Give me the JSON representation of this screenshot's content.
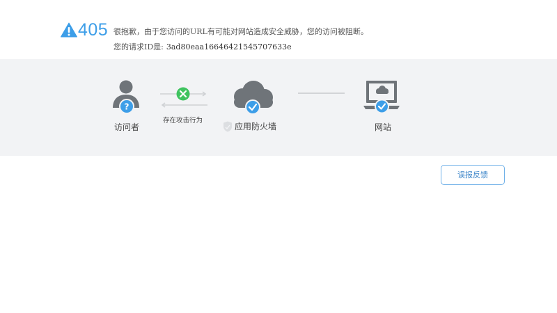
{
  "header": {
    "warning_icon": "warning-triangle-icon",
    "code": "405",
    "message": "很抱歉，由于您访问的URL有可能对网站造成安全威胁，您的访问被阻断。",
    "request_id_label": "您的请求ID是:",
    "request_id": "3ad80eaa16646421545707633e"
  },
  "diagram": {
    "visitor": {
      "label": "访问者",
      "icon": "user-question-icon"
    },
    "attack": {
      "label": "存在攻击行为",
      "icon": "blocked-x-icon"
    },
    "firewall": {
      "label": "应用防火墙",
      "icon": "cloud-check-icon",
      "badge_icon": "shield-icon"
    },
    "website": {
      "label": "网站",
      "icon": "laptop-cloud-check-icon"
    }
  },
  "actions": {
    "feedback_label": "误报反馈"
  },
  "colors": {
    "accent": "#3d9ee8",
    "success": "#3fc35f",
    "icon_gray": "#6f7479",
    "band_bg": "#f2f3f5"
  }
}
